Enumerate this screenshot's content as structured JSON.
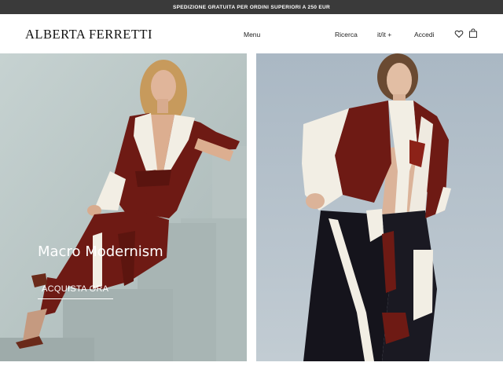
{
  "promo": {
    "text": "SPEDIZIONE GRATUITA PER ORDINI SUPERIORI A 250 EUR"
  },
  "header": {
    "logo": "ALBERTA FERRETTI",
    "menu_label": "Menu",
    "search_label": "Ricerca",
    "lang_label": "it/it +",
    "login_label": "Accedi",
    "icons": [
      "heart-icon",
      "shopping-bag-icon"
    ]
  },
  "hero": {
    "title": "Macro Modernism",
    "cta_label": "ACQUISTA ORA"
  },
  "colors": {
    "promo_bg": "#3a3a3a",
    "garment_burgundy": "#6e1a14",
    "garment_cream": "#f2eee4",
    "left_bg": "#bcc9c9",
    "right_bg": "#b6c2cc"
  }
}
